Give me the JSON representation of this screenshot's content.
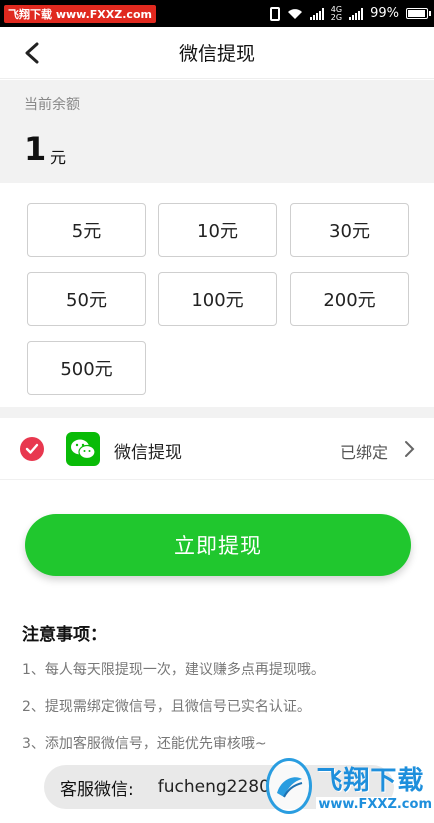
{
  "status_bar": {
    "watermark": "飞翔下载 www.FXXZ.com",
    "network_top": "4G",
    "network_bottom": "2G",
    "battery": "99%"
  },
  "header": {
    "title": "微信提现"
  },
  "balance": {
    "label": "当前余额",
    "value": "1",
    "unit": "元"
  },
  "amounts": [
    "5元",
    "10元",
    "30元",
    "50元",
    "100元",
    "200元",
    "500元"
  ],
  "payment": {
    "label": "微信提现",
    "status": "已绑定",
    "selected": true
  },
  "withdraw_button": "立即提现",
  "notes": {
    "title": "注意事项：",
    "items": [
      "1、每人每天限提现一次，建议赚多点再提现哦。",
      "2、提现需绑定微信号，且微信号已实名认证。",
      "3、添加客服微信号，还能优先审核哦~"
    ]
  },
  "service": {
    "label": "客服微信:",
    "value": "fucheng2280"
  },
  "site_watermark": {
    "brand": "飞翔下载",
    "url": "www.FXXZ.com"
  },
  "colors": {
    "accent_green": "#20c72e",
    "check_red": "#e8384f",
    "wechat_green": "#09bb07"
  }
}
